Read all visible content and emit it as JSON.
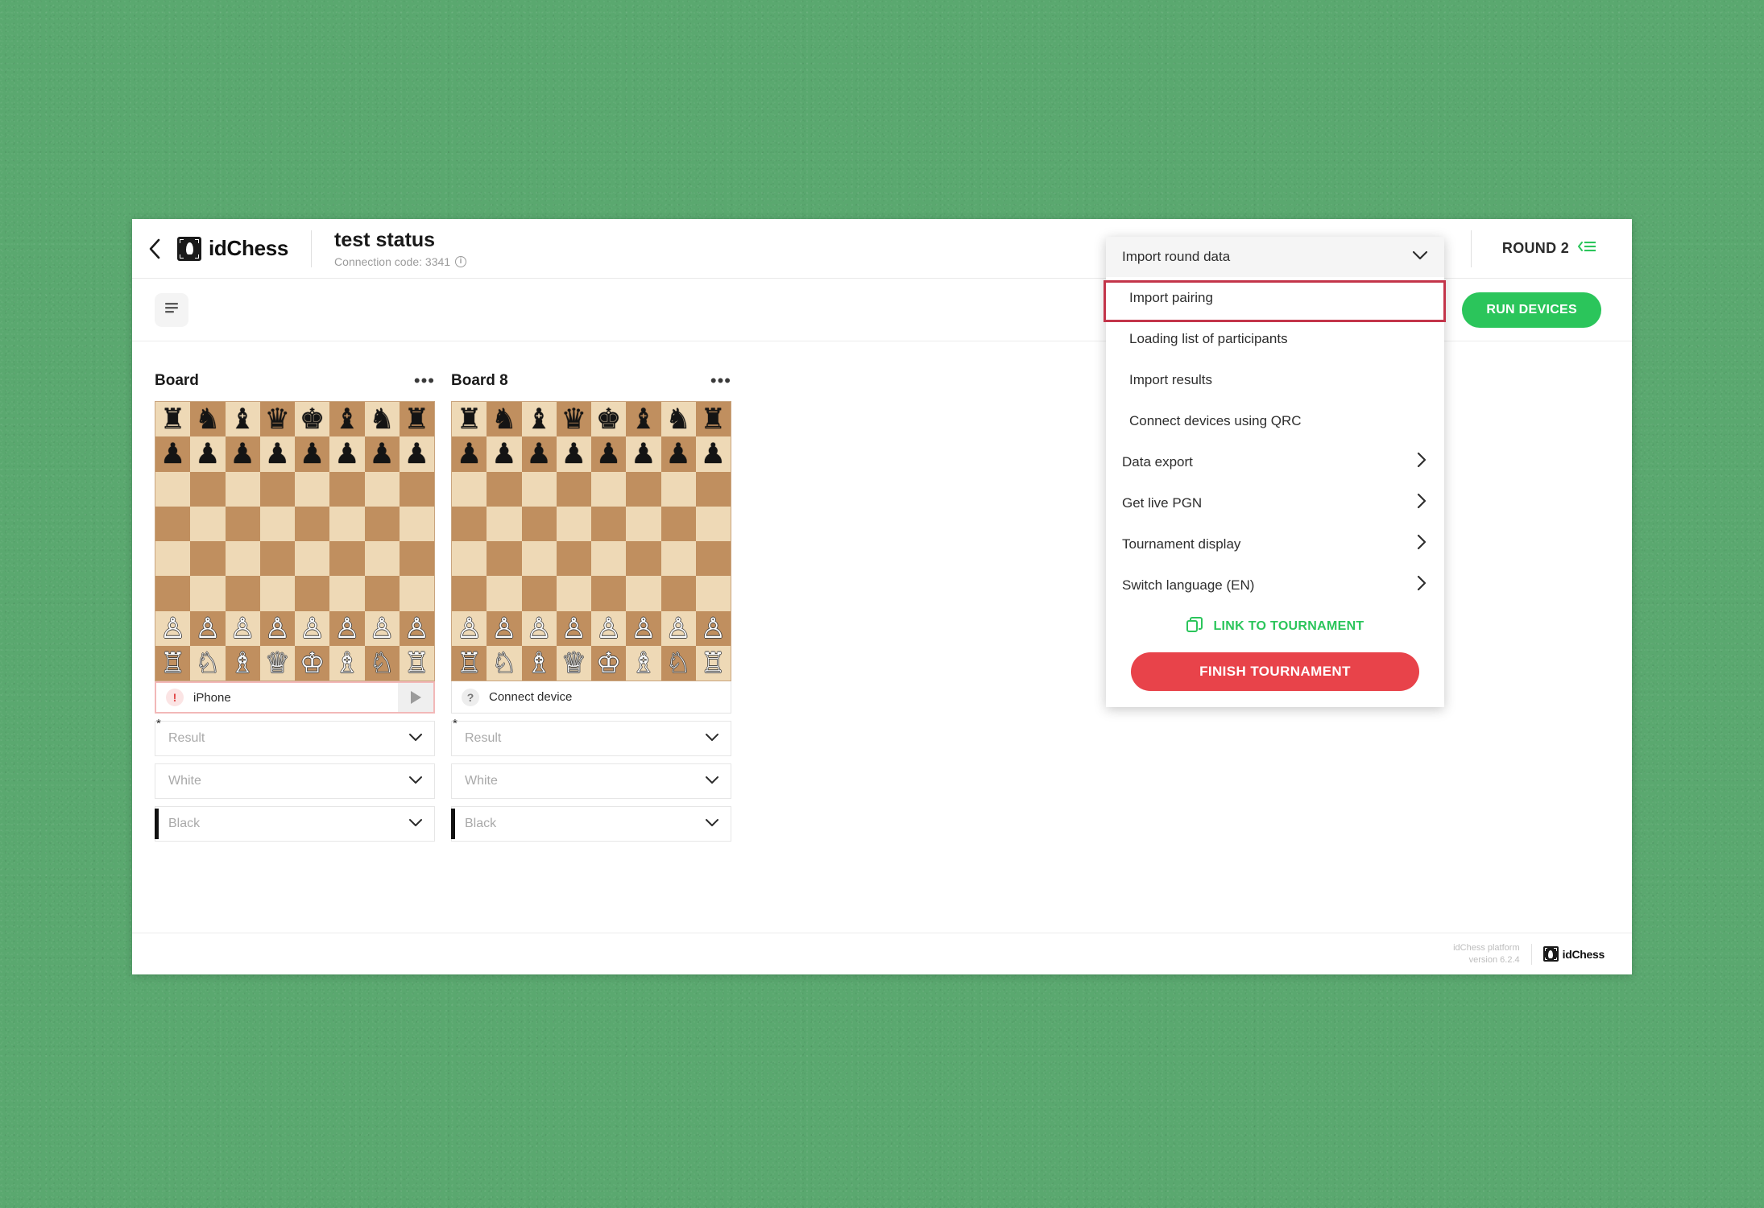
{
  "header": {
    "back_icon": "chevron-left-icon",
    "brand_name": "idChess",
    "title": "test status",
    "connection_code": "Connection code: 3341",
    "info_icon": "info-icon",
    "round_label": "ROUND 2",
    "round_icon": "round-list-icon"
  },
  "toolbar": {
    "filter_icon": "filter-lines-icon",
    "camera_icon": "device-camera-icon",
    "run_devices_label": "RUN DEVICES"
  },
  "boards": [
    {
      "title": "Board",
      "menu_icon": "more-options-icon",
      "device": {
        "status_icon": "warning-icon",
        "status_glyph": "!",
        "name": "iPhone",
        "play_icon": "play-icon",
        "alert": true,
        "has_play": true
      },
      "selects": [
        {
          "name": "result",
          "placeholder": "Result",
          "required": true,
          "color_bar": "none"
        },
        {
          "name": "white",
          "placeholder": "White",
          "required": false,
          "color_bar": "white"
        },
        {
          "name": "black",
          "placeholder": "Black",
          "required": false,
          "color_bar": "black"
        }
      ]
    },
    {
      "title": "Board 8",
      "menu_icon": "more-options-icon",
      "device": {
        "status_icon": "question-icon",
        "status_glyph": "?",
        "name": "Connect device",
        "play_icon": "play-icon",
        "alert": false,
        "has_play": false
      },
      "selects": [
        {
          "name": "result",
          "placeholder": "Result",
          "required": true,
          "color_bar": "none"
        },
        {
          "name": "white",
          "placeholder": "White",
          "required": false,
          "color_bar": "white"
        },
        {
          "name": "black",
          "placeholder": "Black",
          "required": false,
          "color_bar": "black"
        }
      ]
    }
  ],
  "menu": {
    "header_label": "Import round data",
    "header_chevron": "chevron-down-icon",
    "sub_items": [
      {
        "label": "Import pairing",
        "highlighted": true
      },
      {
        "label": "Loading list of participants",
        "highlighted": false
      },
      {
        "label": "Import results",
        "highlighted": false
      },
      {
        "label": "Connect devices using QRC",
        "highlighted": false
      }
    ],
    "main_items": [
      {
        "label": "Data export",
        "chevron": "chevron-right-icon"
      },
      {
        "label": "Get live PGN",
        "chevron": "chevron-right-icon"
      },
      {
        "label": "Tournament display",
        "chevron": "chevron-right-icon"
      },
      {
        "label": "Switch language (EN)",
        "chevron": "chevron-right-icon"
      }
    ],
    "link_label": "LINK TO TOURNAMENT",
    "link_icon": "copy-icon",
    "finish_label": "FINISH TOURNAMENT"
  },
  "footer": {
    "version_line1": "idChess platform",
    "version_line2": "version 6.2.4",
    "brand_name": "idChess"
  },
  "colors": {
    "backdrop": "#5aa86f",
    "accent_green": "#2bc55b",
    "danger_red": "#e8434a",
    "highlight_red": "#c3354a",
    "board_light": "#eed9b6",
    "board_dark": "#c08f5f"
  },
  "board_position": [
    [
      "r",
      "n",
      "b",
      "q",
      "k",
      "b",
      "n",
      "r"
    ],
    [
      "p",
      "p",
      "p",
      "p",
      "p",
      "p",
      "p",
      "p"
    ],
    [
      "",
      "",
      "",
      "",
      "",
      "",
      "",
      ""
    ],
    [
      "",
      "",
      "",
      "",
      "",
      "",
      "",
      ""
    ],
    [
      "",
      "",
      "",
      "",
      "",
      "",
      "",
      ""
    ],
    [
      "",
      "",
      "",
      "",
      "",
      "",
      "",
      ""
    ],
    [
      "P",
      "P",
      "P",
      "P",
      "P",
      "P",
      "P",
      "P"
    ],
    [
      "R",
      "N",
      "B",
      "Q",
      "K",
      "B",
      "N",
      "R"
    ]
  ]
}
